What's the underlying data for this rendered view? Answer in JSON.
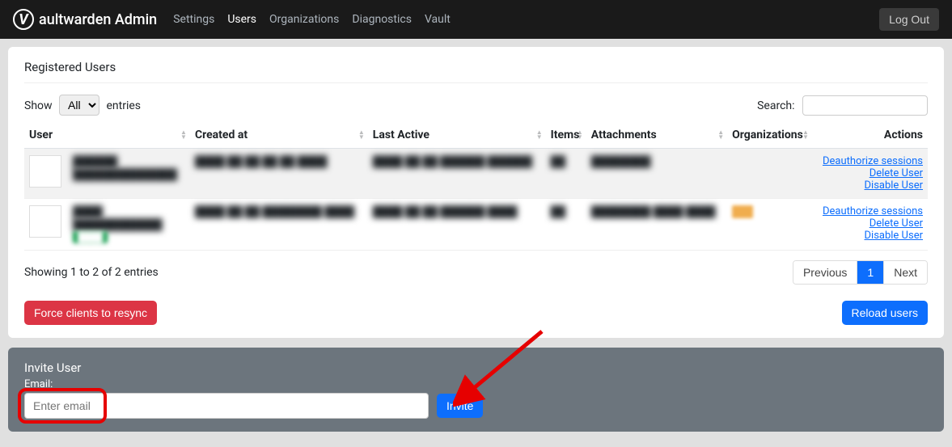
{
  "nav": {
    "brand": "aultwarden Admin",
    "links": [
      {
        "label": "Settings",
        "active": false
      },
      {
        "label": "Users",
        "active": true
      },
      {
        "label": "Organizations",
        "active": false
      },
      {
        "label": "Diagnostics",
        "active": false
      },
      {
        "label": "Vault",
        "active": false
      }
    ],
    "logout": "Log Out"
  },
  "card": {
    "title": "Registered Users",
    "show_label": "Show",
    "entries_label": "entries",
    "entries_value": "All",
    "search_label": "Search:",
    "columns": {
      "user": "User",
      "created": "Created at",
      "last_active": "Last Active",
      "items": "Items",
      "attachments": "Attachments",
      "organizations": "Organizations",
      "actions": "Actions"
    },
    "rows": [
      {
        "user_name": "██████",
        "user_email": "██████████████",
        "created": "████ ██\n██ ██ ██\n████",
        "last_active": "████ ██ ██\n██████\n██████",
        "items": "██",
        "attachments": "████████",
        "organizations": "",
        "actions": {
          "deauth": "Deauthorize sessions",
          "delete": "Delete User",
          "disable": "Disable User"
        }
      },
      {
        "user_name": "████",
        "user_email": "████████████",
        "user_badge": "████",
        "created": "████ ██ ██\n████████\n████",
        "last_active": "████ ██ ██\n██████\n████",
        "items": "██",
        "attachments": "████████\n████ ████",
        "organizations": "badge",
        "actions": {
          "deauth": "Deauthorize sessions",
          "delete": "Delete User",
          "disable": "Disable User"
        }
      }
    ],
    "showing_text": "Showing 1 to 2 of 2 entries",
    "pagination": {
      "prev": "Previous",
      "page": "1",
      "next": "Next"
    },
    "force_resync": "Force clients to resync",
    "reload": "Reload users"
  },
  "invite": {
    "title": "Invite User",
    "label": "Email:",
    "placeholder": "Enter email",
    "button": "Invite"
  }
}
